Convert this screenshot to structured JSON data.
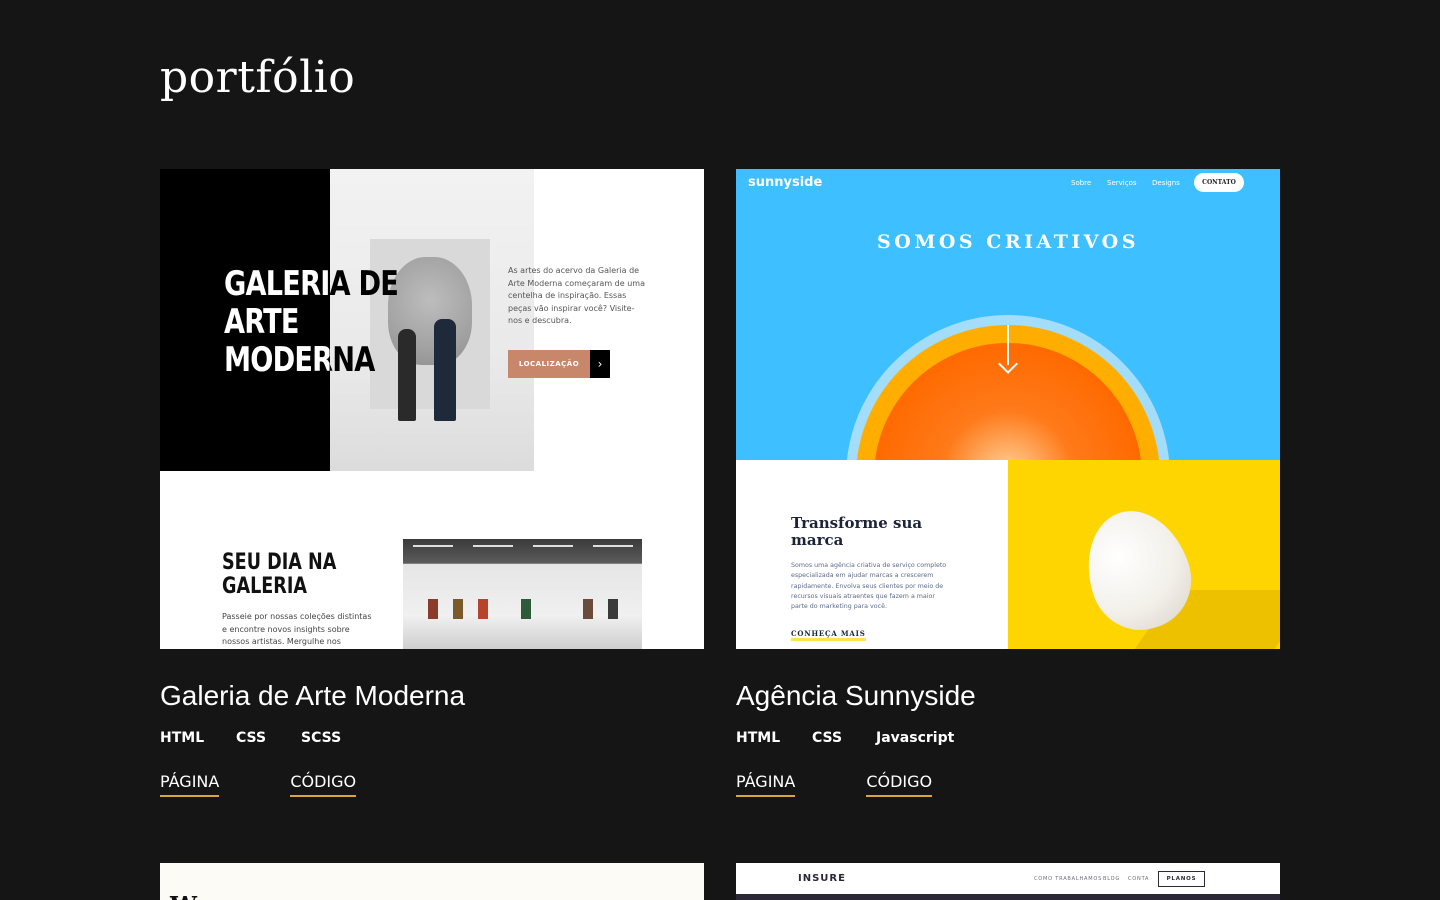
{
  "page": {
    "title": "portfólio"
  },
  "projects": [
    {
      "title": "Galeria de Arte Moderna",
      "tags": [
        "HTML",
        "CSS",
        "SCSS"
      ],
      "links": {
        "page": "PÁGINA",
        "code": "CÓDIGO"
      },
      "preview": {
        "hero_title": "GALERIA DE\nARTE\nMODERNA",
        "description": "As artes do acervo da Galeria de Arte Moderna começaram de uma centelha de inspiração. Essas peças vão inspirar você? Visite-nos e descubra.",
        "button_label": "LOCALIZAÇÃO",
        "button_arrow": "›",
        "section_title": "SEU DIA NA\nGALERIA",
        "section_text": "Passeie por nossas coleções distintas e encontre novos insights sobre nossos artistas. Mergulhe nos"
      }
    },
    {
      "title": "Agência Sunnyside",
      "tags": [
        "HTML",
        "CSS",
        "Javascript"
      ],
      "links": {
        "page": "PÁGINA",
        "code": "CÓDIGO"
      },
      "preview": {
        "logo": "sunnyside",
        "nav": [
          "Sobre",
          "Serviços",
          "Designs"
        ],
        "contact_label": "CONTATO",
        "hero_title": "SOMOS CRIATIVOS",
        "section_title": "Transforme sua marca",
        "section_text": "Somos uma agência criativa de serviço completo especializada em ajudar marcas a crescerem rapidamente. Envolva seus clientes por meio de recursos visuais atraentes que fazem a maior parte do marketing para você.",
        "learn_more": "CONHEÇA MAIS"
      }
    },
    {
      "preview": {
        "glyph": "W"
      }
    },
    {
      "preview": {
        "logo": "INSURE",
        "nav": [
          "COMO TRABALHAMOS",
          "BLOG",
          "CONTA"
        ],
        "button_label": "PLANOS"
      }
    }
  ],
  "colors": {
    "background": "#151515",
    "link_underline": "#d9a441",
    "galeria_accent": "#c8876a",
    "sunnyside_blue": "#3ebfff",
    "sunnyside_yellow": "#ffd500"
  }
}
